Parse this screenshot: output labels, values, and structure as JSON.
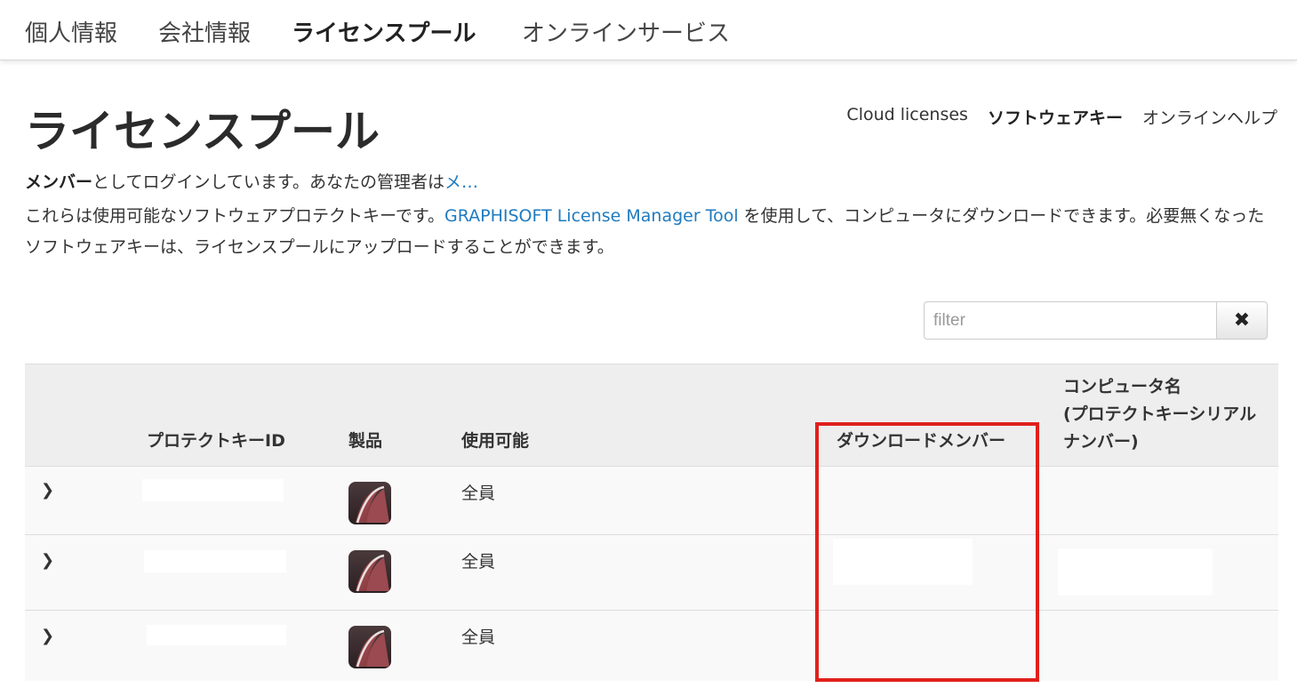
{
  "topnav": {
    "tabs": [
      {
        "label": "個人情報",
        "active": false
      },
      {
        "label": "会社情報",
        "active": false
      },
      {
        "label": "ライセンスプール",
        "active": true
      },
      {
        "label": "オンラインサービス",
        "active": false
      }
    ]
  },
  "header": {
    "title": "ライセンスプール",
    "links": [
      {
        "label": "Cloud licenses",
        "active": false
      },
      {
        "label": "ソフトウェアキー",
        "active": true
      },
      {
        "label": "オンラインヘルプ",
        "active": false
      }
    ]
  },
  "login": {
    "role": "メンバー",
    "text": "としてログインしています。あなたの管理者は",
    "admin": "メ…"
  },
  "description": {
    "before_link": "これらは使用可能なソフトウェアプロテクトキーです。",
    "link": "GRAPHISOFT License Manager Tool",
    "after_link": " を使用して、コンピュータにダウンロードできます。必要無くなったソフトウェアキーは、ライセンスプールにアップロードすることができます。"
  },
  "filter": {
    "placeholder": "filter",
    "value": "",
    "clear_icon": "✖"
  },
  "table": {
    "columns": {
      "key_id": "プロテクトキーID",
      "product": "製品",
      "availability": "使用可能",
      "download_member": "ダウンロードメンバー",
      "computer_name": "コンピュータ名\n(プロテクトキーシリアルナンバー)"
    },
    "rows": [
      {
        "availability": "全員",
        "product_icon": "archicad-icon"
      },
      {
        "availability": "全員",
        "product_icon": "archicad-icon"
      },
      {
        "availability": "全員",
        "product_icon": "archicad-icon"
      }
    ]
  },
  "colors": {
    "link": "#1f7bbf",
    "highlight": "#e0201c",
    "header_bg": "#eeeeee",
    "row_bg": "#f9f9f9"
  }
}
